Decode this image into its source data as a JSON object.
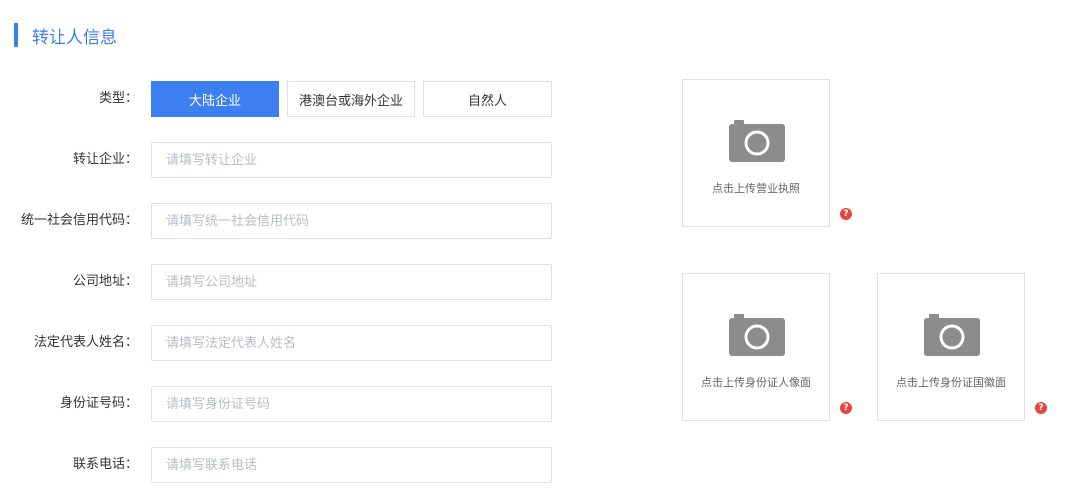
{
  "section": {
    "title": "转让人信息"
  },
  "form": {
    "type": {
      "label": "类型：",
      "options": [
        "大陆企业",
        "港澳台或海外企业",
        "自然人"
      ],
      "selected": "大陆企业"
    },
    "company": {
      "label": "转让企业：",
      "placeholder": "请填写转让企业"
    },
    "credit_code": {
      "label": "统一社会信用代码：",
      "placeholder": "请填写统一社会信用代码"
    },
    "address": {
      "label": "公司地址：",
      "placeholder": "请填写公司地址"
    },
    "legal_rep": {
      "label": "法定代表人姓名：",
      "placeholder": "请填写法定代表人姓名"
    },
    "id_number": {
      "label": "身份证号码：",
      "placeholder": "请填写身份证号码"
    },
    "phone": {
      "label": "联系电话：",
      "placeholder": "请填写联系电话"
    }
  },
  "uploads": {
    "license": {
      "text": "点击上传营业执照",
      "icon": "camera-icon"
    },
    "id_front": {
      "text": "点击上传身份证人像面",
      "icon": "camera-icon"
    },
    "id_back": {
      "text": "点击上传身份证国徽面",
      "icon": "camera-icon"
    }
  },
  "help_mark": "?",
  "colors": {
    "accent": "#3d7ef0",
    "help": "#e8453c",
    "border": "#dcdfe6"
  }
}
